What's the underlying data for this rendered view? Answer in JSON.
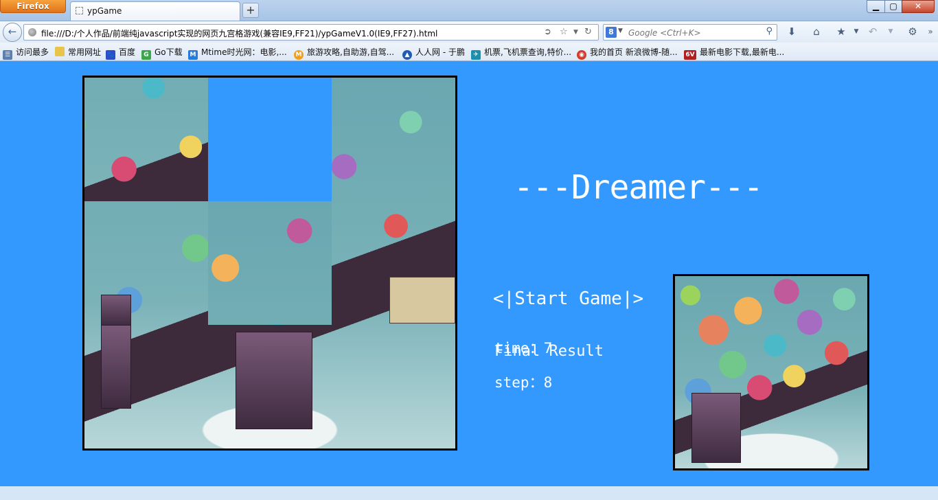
{
  "browser": {
    "app_button": "Firefox",
    "tab_title": "ypGame",
    "new_tab": "+",
    "window_controls": {
      "minimize": "▁",
      "maximize": "▢",
      "close": "✕"
    },
    "url": "file:///D:/个人作品/前端纯javascript实现的网页九宫格游戏(兼容IE9,FF21)/ypGameV1.0(IE9,FF27).html",
    "search_placeholder": "Google <Ctrl+K>",
    "search_engine_icon": "google-icon",
    "toolbar_icons": [
      "download-icon",
      "home-icon",
      "bookmarks-icon",
      "undo-icon",
      "addon-icon"
    ]
  },
  "bookmarks": [
    {
      "label": "访问最多",
      "icon": "most-visited-icon",
      "color": "#5a7fb0"
    },
    {
      "label": "常用网址",
      "icon": "folder-icon",
      "color": "#e8c44a"
    },
    {
      "label": "百度",
      "icon": "baidu-icon",
      "color": "#2b4fc9"
    },
    {
      "label": "Go下载",
      "icon": "download-site-icon",
      "color": "#3aa84a"
    },
    {
      "label": "Mtime时光网：电影,...",
      "icon": "mtime-icon",
      "color": "#2a7ad8"
    },
    {
      "label": "旅游攻略,自助游,自驾...",
      "icon": "travel-icon",
      "color": "#f0a020"
    },
    {
      "label": "人人网 - 于鹏",
      "icon": "renren-icon",
      "color": "#1f5ab5"
    },
    {
      "label": "机票,飞机票查询,特价...",
      "icon": "flight-icon",
      "color": "#1a8fb0"
    },
    {
      "label": "我的首页 新浪微博-随...",
      "icon": "weibo-icon",
      "color": "#d83a2a"
    },
    {
      "label": "最新电影下载,最新电...",
      "icon": "movie-icon",
      "color": "#b02020"
    }
  ],
  "game": {
    "title": "---Dreamer---",
    "start_button": "<|Start Game|>",
    "final_result_label": "Final Result",
    "time_label": "time：7",
    "step_label": "step：8",
    "time_value": 7,
    "step_value": 8,
    "empty_tile_index": 1,
    "tiles": [
      "puzzle-tile-1",
      "empty",
      "puzzle-tile-3",
      "puzzle-tile-4",
      "puzzle-tile-5",
      "puzzle-tile-6",
      "puzzle-tile-7",
      "puzzle-tile-8",
      "puzzle-tile-9"
    ]
  },
  "colors": {
    "page_background": "#3399ff",
    "text": "#ffffff",
    "border": "#000000"
  }
}
